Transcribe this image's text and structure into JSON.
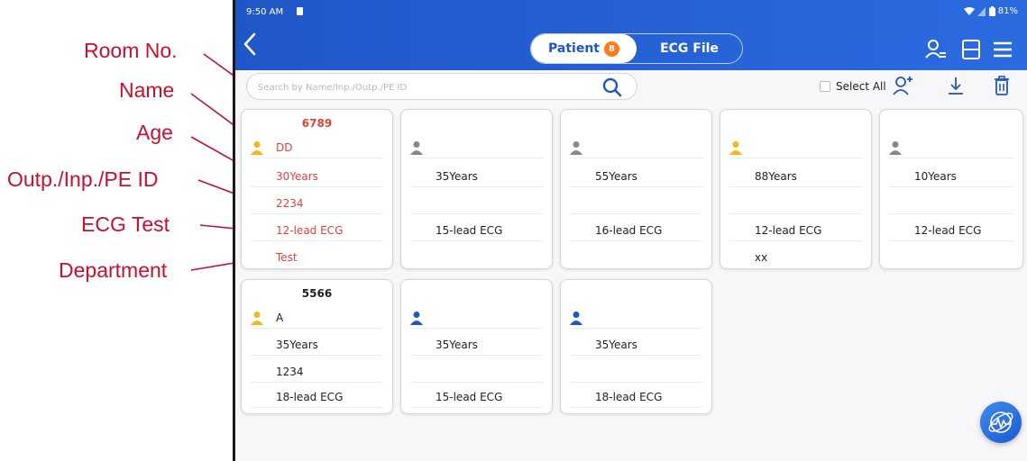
{
  "callouts": [
    "Room No.",
    "Name",
    "Age",
    "Outp./Inp./PE ID",
    "ECG Test",
    "Department"
  ],
  "status_bar": {
    "time": "9:50 AM",
    "battery": "81%"
  },
  "tabs": [
    {
      "label": "Patient",
      "badge": "8",
      "active": true
    },
    {
      "label": "ECG File",
      "active": false
    }
  ],
  "search": {
    "placeholder": "Search by Name/Inp./Outp./PE ID"
  },
  "select_all": {
    "label": "Select All",
    "checked": false
  },
  "icons": {
    "back": "back-arrow-icon",
    "user_filter": "user-filter-icon",
    "layout": "layout-icon",
    "menu": "menu-icon",
    "search": "search-icon",
    "add_patient": "add-user-icon",
    "download": "download-icon",
    "delete": "trash-icon",
    "fab": "ecg-device-icon"
  },
  "colors": {
    "brand": "#1f57c8",
    "highlight": "#e0423c",
    "badge": "#ff7a1a",
    "patient_icon_yellow": "#f2b71b",
    "patient_icon_gray": "#888888",
    "patient_icon_blue": "#1f57c8",
    "callout": "#c8102e"
  },
  "patients": [
    {
      "room": "6789",
      "icon": "yellow",
      "name": "DD",
      "age": "30Years",
      "id": "2234",
      "ecg": "12-lead ECG",
      "department": "Test",
      "highlighted": true
    },
    {
      "room": "",
      "icon": "gray",
      "name": "",
      "age": "35Years",
      "id": "",
      "ecg": "15-lead ECG",
      "department": ""
    },
    {
      "room": "",
      "icon": "gray",
      "name": "",
      "age": "55Years",
      "id": "",
      "ecg": "16-lead ECG",
      "department": ""
    },
    {
      "room": "",
      "icon": "yellow",
      "name": "",
      "age": "88Years",
      "id": "",
      "ecg": "12-lead ECG",
      "department": "xx"
    },
    {
      "room": "",
      "icon": "gray",
      "name": "",
      "age": "10Years",
      "id": "",
      "ecg": "12-lead ECG",
      "department": ""
    },
    {
      "room": "5566",
      "icon": "yellow",
      "name": "A",
      "age": "35Years",
      "id": "1234",
      "ecg": "18-lead ECG",
      "department": ""
    },
    {
      "room": "",
      "icon": "blue",
      "name": "",
      "age": "35Years",
      "id": "",
      "ecg": "15-lead ECG",
      "department": ""
    },
    {
      "room": "",
      "icon": "blue",
      "name": "",
      "age": "35Years",
      "id": "",
      "ecg": "18-lead ECG",
      "department": ""
    }
  ]
}
